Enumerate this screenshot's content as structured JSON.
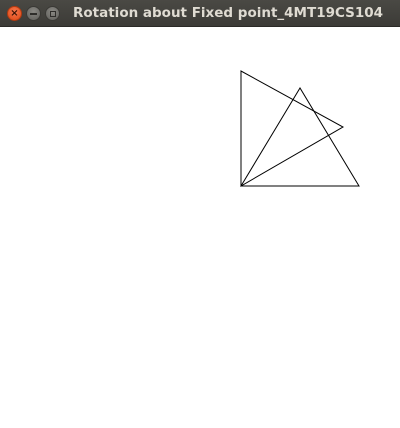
{
  "window": {
    "title": "Rotation about Fixed point_4MT19CS104",
    "close_icon": "close-icon",
    "minimize_icon": "minimize-icon",
    "maximize_icon": "maximize-icon"
  },
  "colors": {
    "titlebar": "#3c3b37",
    "title_text": "#dfdbd2",
    "close_button": "#dd4814",
    "canvas_background": "#ffffff",
    "stroke": "#000000"
  }
}
